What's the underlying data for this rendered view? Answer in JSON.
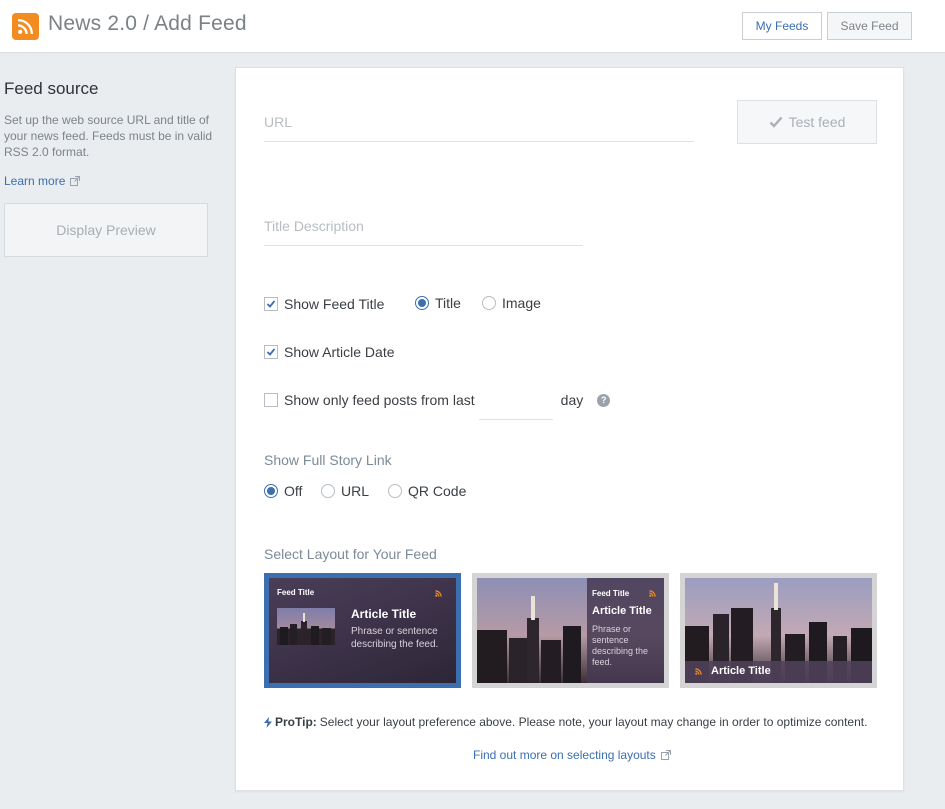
{
  "header": {
    "title": "News 2.0 / Add Feed",
    "my_feeds": "My Feeds",
    "save_feed": "Save Feed",
    "icon": "rss-icon",
    "accent": "#f28b20"
  },
  "sidebar": {
    "title": "Feed source",
    "description": "Set up the web source URL and title of your news feed. Feeds must be in valid RSS 2.0 format.",
    "learn_more": "Learn more",
    "display_preview": "Display Preview"
  },
  "form": {
    "url_placeholder": "URL",
    "test_feed": "Test feed",
    "title_placeholder": "Title Description",
    "show_feed_title": {
      "label": "Show Feed Title",
      "checked": true
    },
    "feed_title_mode": {
      "title": "Title",
      "image": "Image",
      "selected": "Title"
    },
    "show_article_date": {
      "label": "Show Article Date",
      "checked": true
    },
    "show_only_last": {
      "label": "Show only feed posts from last",
      "checked": false,
      "value": "",
      "unit": "day"
    },
    "full_story": {
      "label": "Show Full Story Link",
      "options": [
        "Off",
        "URL",
        "QR Code"
      ],
      "selected": "Off"
    },
    "layout": {
      "label": "Select Layout for Your Feed",
      "selected": 0,
      "cards": [
        {
          "feed_title": "Feed Title",
          "article_title": "Article Title",
          "text": "Phrase or sentence describing the feed."
        },
        {
          "feed_title": "Feed Title",
          "article_title": "Article Title",
          "text": "Phrase or sentence describing the feed."
        },
        {
          "article_title": "Article Title"
        }
      ]
    },
    "protip_label": "ProTip:",
    "protip_text": "Select your layout preference above. Please note, your layout may change in order to optimize content.",
    "find_more": "Find out more on selecting layouts"
  },
  "colors": {
    "link": "#3b6fb0",
    "selected_layout": "#3b6fb0"
  }
}
